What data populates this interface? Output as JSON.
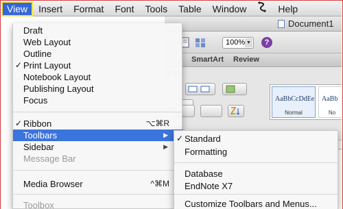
{
  "menubar": {
    "items": [
      "View",
      "Insert",
      "Format",
      "Font",
      "Tools",
      "Table",
      "Window",
      "Help"
    ],
    "script_icon": "script-menu-icon"
  },
  "document": {
    "title": "Document1",
    "zoom": "100%",
    "ribbon_tabs": [
      "SmartArt",
      "Review"
    ],
    "paragraph_group_label": "graph",
    "styles": [
      {
        "sample": "AaBbCcDdEe",
        "name": "Normal"
      },
      {
        "sample": "AaBb",
        "name": "No"
      }
    ]
  },
  "view_menu": {
    "items": [
      {
        "label": "Draft",
        "checked": false,
        "shortcut": "",
        "submenu": false,
        "disabled": false
      },
      {
        "label": "Web Layout",
        "checked": false,
        "shortcut": "",
        "submenu": false,
        "disabled": false
      },
      {
        "label": "Outline",
        "checked": false,
        "shortcut": "",
        "submenu": false,
        "disabled": false
      },
      {
        "label": "Print Layout",
        "checked": true,
        "shortcut": "",
        "submenu": false,
        "disabled": false
      },
      {
        "label": "Notebook Layout",
        "checked": false,
        "shortcut": "",
        "submenu": false,
        "disabled": false
      },
      {
        "label": "Publishing Layout",
        "checked": false,
        "shortcut": "",
        "submenu": false,
        "disabled": false
      },
      {
        "label": "Focus",
        "checked": false,
        "shortcut": "",
        "submenu": false,
        "disabled": false
      },
      {
        "label": "Ribbon",
        "checked": true,
        "shortcut": "⌥⌘R",
        "submenu": false,
        "disabled": false
      },
      {
        "label": "Toolbars",
        "checked": false,
        "shortcut": "",
        "submenu": true,
        "disabled": false,
        "highlighted": true
      },
      {
        "label": "Sidebar",
        "checked": false,
        "shortcut": "",
        "submenu": true,
        "disabled": false
      },
      {
        "label": "Message Bar",
        "checked": false,
        "shortcut": "",
        "submenu": false,
        "disabled": true
      },
      {
        "label": "Media Browser",
        "checked": false,
        "shortcut": "^⌘M",
        "submenu": false,
        "disabled": false
      },
      {
        "label": "Toolbox",
        "checked": false,
        "shortcut": "",
        "submenu": false,
        "disabled": true
      }
    ],
    "check_glyph": "✓",
    "arrow_glyph": "▶"
  },
  "toolbars_submenu": {
    "items": [
      {
        "label": "Standard",
        "checked": true
      },
      {
        "label": "Formatting",
        "checked": false
      },
      {
        "label": "Database",
        "checked": false
      },
      {
        "label": "EndNote X7",
        "checked": false
      },
      {
        "label": "Customize Toolbars and Menus...",
        "checked": false
      }
    ]
  },
  "colors": {
    "menu_highlight": "#3b74dc",
    "menubar_selected": "#3567d6",
    "callout_border": "#d13a3a",
    "selection_outline": "#f4e341"
  }
}
